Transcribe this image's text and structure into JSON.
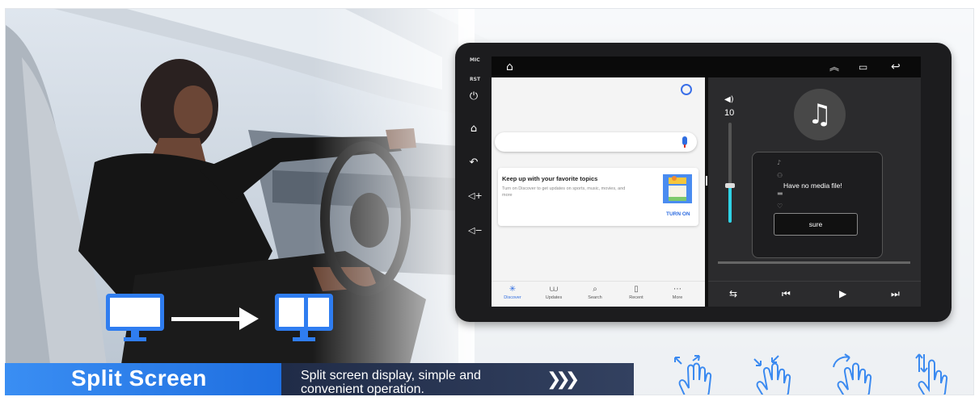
{
  "head_unit": {
    "hw_labels": {
      "mic": "MIC",
      "rst": "RST"
    },
    "hw_buttons": [
      {
        "icon": "power-icon",
        "glyph": "⏻"
      },
      {
        "icon": "home-icon",
        "glyph": "⌂"
      },
      {
        "icon": "back-icon",
        "glyph": "↶"
      },
      {
        "icon": "volume-up-icon",
        "glyph": "◁+"
      },
      {
        "icon": "volume-down-icon",
        "glyph": "◁−"
      }
    ],
    "status_bar": {
      "home_icon": "home-outline-icon",
      "up_icon": "double-chevron-up-icon",
      "recents_icon": "recents-icon",
      "back_icon": "back-arrow-icon"
    }
  },
  "discover_app": {
    "card": {
      "title": "Keep up with your favorite topics",
      "body": "Turn on Discover to get updates on sports, music, movies, and more",
      "action": "TURN ON"
    },
    "nav": [
      {
        "label": "Discover",
        "icon": "discover-icon",
        "glyph": "✳",
        "active": true
      },
      {
        "label": "Updates",
        "icon": "updates-icon",
        "glyph": "⩊",
        "active": false
      },
      {
        "label": "Search",
        "icon": "search-icon",
        "glyph": "⌕",
        "active": false
      },
      {
        "label": "Recent",
        "icon": "recent-icon",
        "glyph": "▯",
        "active": false
      },
      {
        "label": "More",
        "icon": "more-icon",
        "glyph": "⋯",
        "active": false
      }
    ]
  },
  "media_app": {
    "volume_value": "10",
    "volume_level_fraction": 0.36,
    "dialog": {
      "message": "Have no media file!",
      "button": "sure"
    },
    "controls": [
      {
        "icon": "repeat-icon",
        "glyph": "⇆"
      },
      {
        "icon": "previous-icon",
        "glyph": "⏮"
      },
      {
        "icon": "play-icon",
        "glyph": "▶"
      },
      {
        "icon": "next-icon",
        "glyph": "⏭"
      }
    ]
  },
  "banner": {
    "title": "Split Screen",
    "description": "Split screen display, simple and convenient operation.",
    "colors": {
      "primary": "#2f7df0",
      "dark": "#202c48"
    }
  },
  "gestures": [
    "pinch-out-gesture-icon",
    "pinch-in-gesture-icon",
    "rotate-gesture-icon",
    "swipe-vertical-gesture-icon"
  ]
}
